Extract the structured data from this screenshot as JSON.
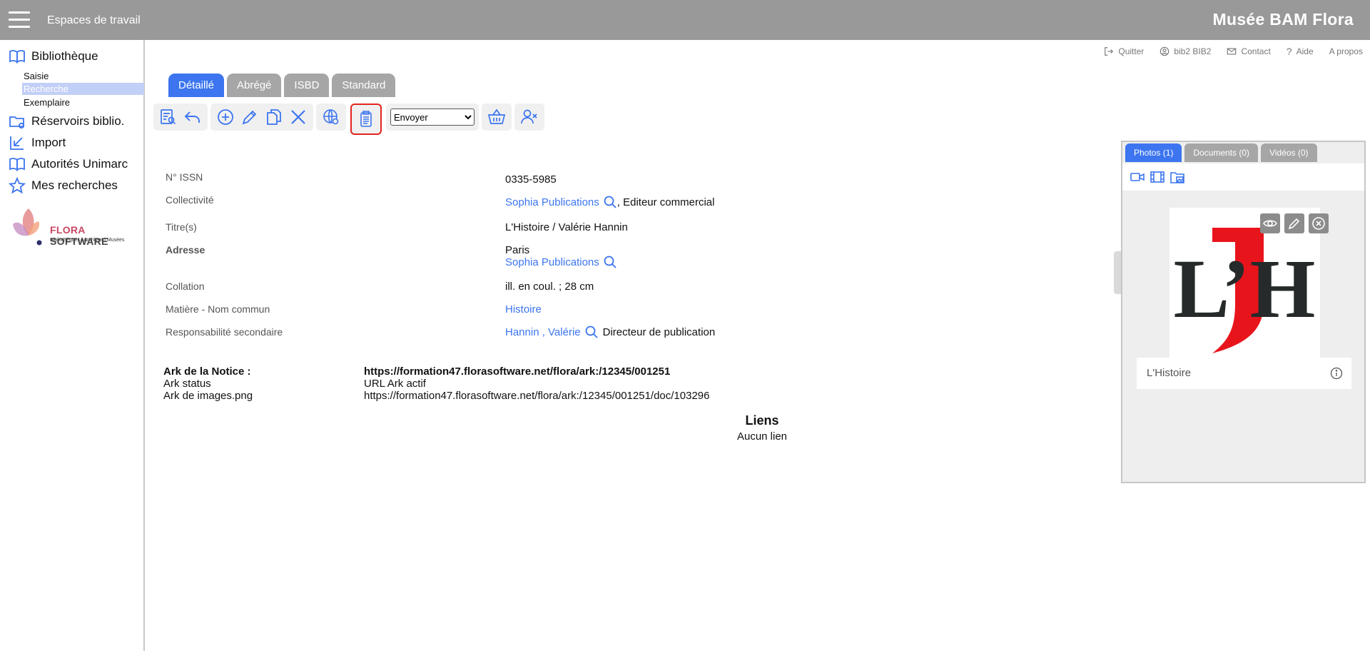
{
  "topbar": {
    "workspaces": "Espaces de travail",
    "brand": "Musée BAM Flora"
  },
  "sidebar": {
    "bibliotheque": "Bibliothèque",
    "sub": [
      "Saisie",
      "Recherche",
      "Exemplaire"
    ],
    "reservoirs": "Réservoirs biblio.",
    "import": "Import",
    "autorites": "Autorités Unimarc",
    "mes_recherches": "Mes recherches",
    "logo_brand_a": "FLORA",
    "logo_brand_b": " SOFTWARE",
    "logo_tagline": "Bibliothèques | Archives | Musées"
  },
  "userbar": {
    "quitter": "Quitter",
    "user": "bib2 BIB2",
    "contact": "Contact",
    "aide": "Aide",
    "apropos": "A propos"
  },
  "tabs": [
    "Détaillé",
    "Abrégé",
    "ISBD",
    "Standard"
  ],
  "toolbar": {
    "send_select": "Envoyer"
  },
  "fields": {
    "issn_label": "N° ISSN",
    "issn_value": "0335-5985",
    "collectivite_label": "Collectivité",
    "collectivite_link": "Sophia Publications",
    "collectivite_role": ", Editeur commercial",
    "titres_label": "Titre(s)",
    "titres_value": "L'Histoire / Valérie Hannin",
    "adresse_label": "Adresse",
    "adresse_city": "Paris",
    "adresse_link": "Sophia Publications",
    "collation_label": "Collation",
    "collation_value": "ill. en coul. ; 28 cm",
    "matiere_label": "Matière - Nom commun",
    "matiere_value": "Histoire",
    "resp_label": "Responsabilité secondaire",
    "resp_link": "Hannin , Valérie",
    "resp_role": "Directeur de publication"
  },
  "ark": {
    "notice_label": "Ark de la Notice :",
    "notice_value": "https://formation47.florasoftware.net/flora/ark:/12345/001251",
    "status_label": "Ark status",
    "status_value": "URL Ark actif",
    "images_label": "Ark de images.png",
    "images_value": "https://formation47.florasoftware.net/flora/ark:/12345/001251/doc/103296"
  },
  "liens": {
    "title": "Liens",
    "value": "Aucun lien"
  },
  "media": {
    "tabs": [
      "Photos (1)",
      "Documents (0)",
      "Vidéos (0)"
    ],
    "logo_text": "L’H",
    "caption": "L'Histoire"
  },
  "colors": {
    "accent": "#3c75ef",
    "topbar": "#999999",
    "highlight": "#e3241f",
    "logo_red": "#e8141b"
  }
}
